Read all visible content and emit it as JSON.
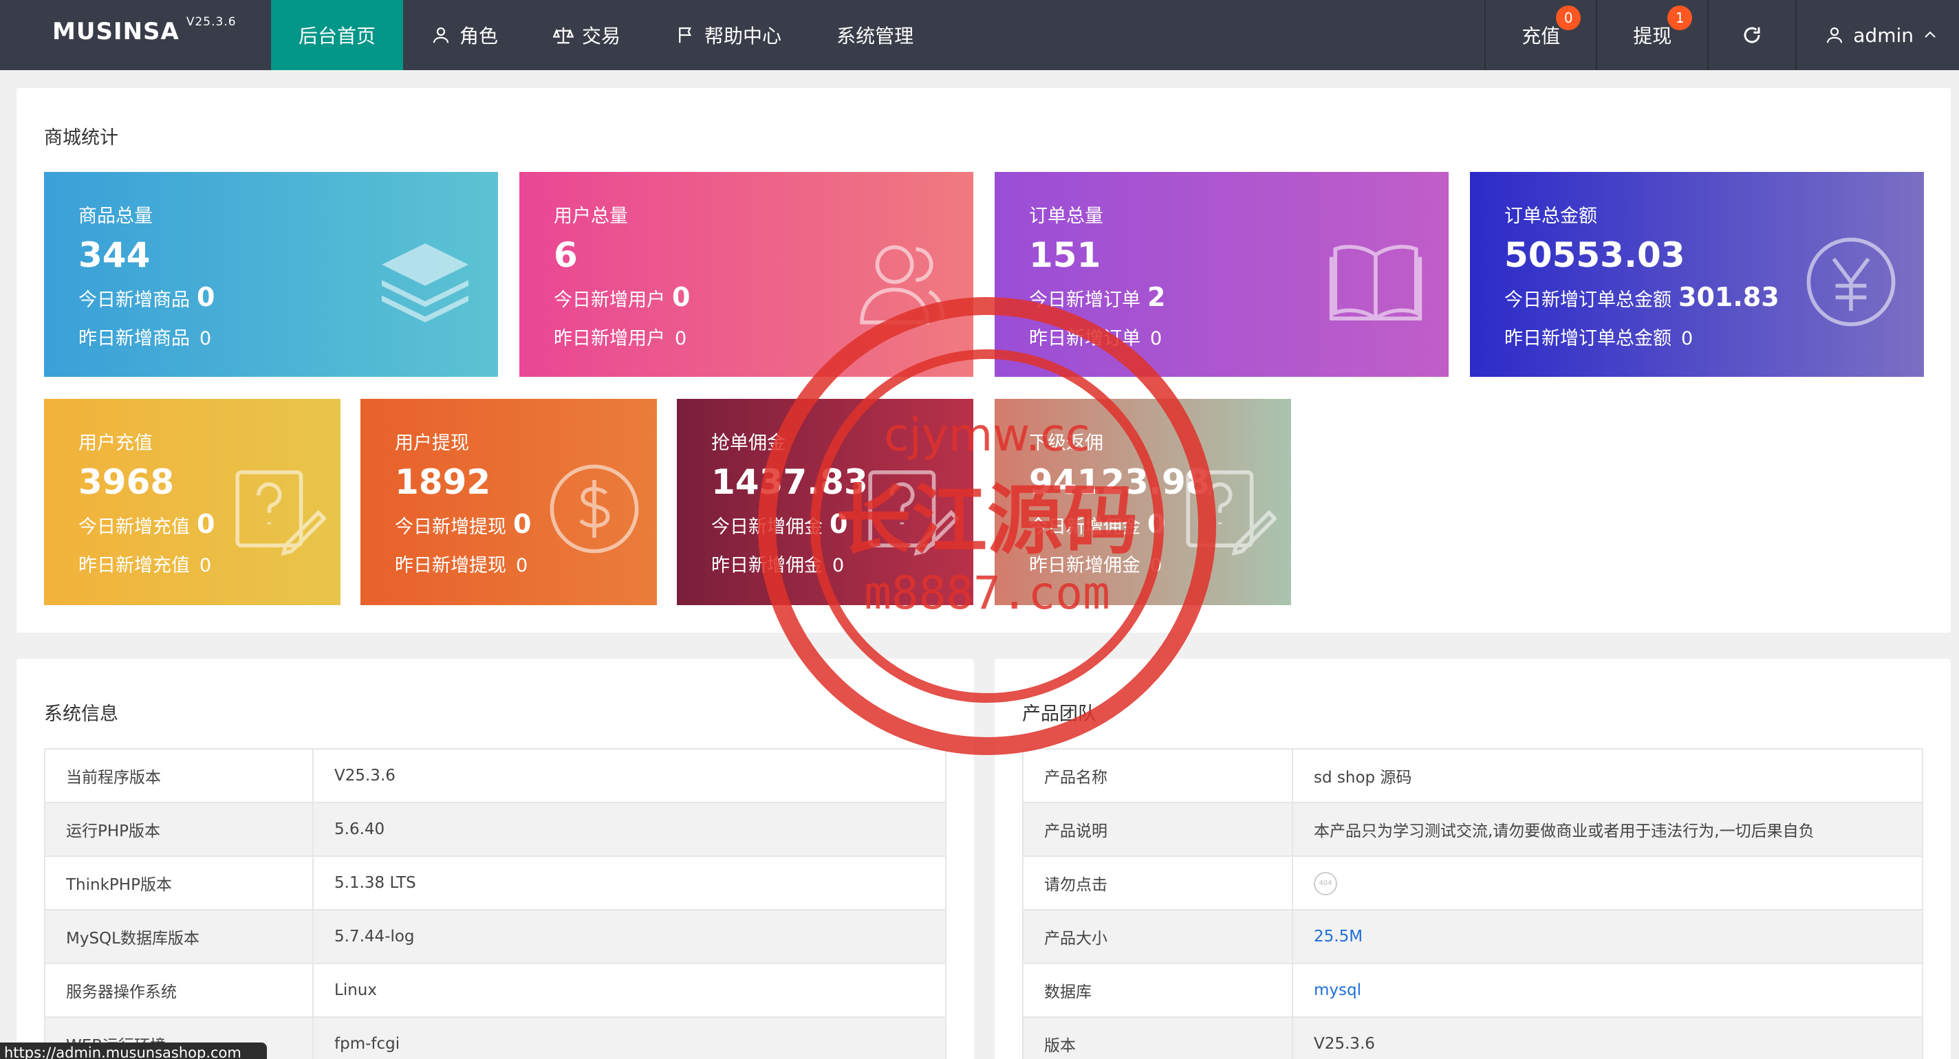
{
  "header": {
    "brand": "MUSINSA",
    "version": "V25.3.6",
    "nav": [
      {
        "label": "后台首页",
        "icon": "",
        "active": true
      },
      {
        "label": "角色",
        "icon": "user-icon"
      },
      {
        "label": "交易",
        "icon": "scale-icon"
      },
      {
        "label": "帮助中心",
        "icon": "flag-icon"
      },
      {
        "label": "系统管理",
        "icon": ""
      }
    ],
    "recharge": {
      "label": "充值",
      "badge": "0"
    },
    "withdraw": {
      "label": "提现",
      "badge": "1"
    },
    "refresh_icon": "refresh-icon",
    "user": {
      "label": "admin",
      "icon": "user-icon"
    }
  },
  "stats": {
    "title": "商城统计",
    "cards": [
      {
        "label": "商品总量",
        "value": "344",
        "today_label": "今日新增商品",
        "today": "0",
        "yesterday_label": "昨日新增商品",
        "yesterday": "0",
        "icon": "layers-icon"
      },
      {
        "label": "用户总量",
        "value": "6",
        "today_label": "今日新增用户",
        "today": "0",
        "yesterday_label": "昨日新增用户",
        "yesterday": "0",
        "icon": "users-icon"
      },
      {
        "label": "订单总量",
        "value": "151",
        "today_label": "今日新增订单",
        "today": "2",
        "yesterday_label": "昨日新增订单",
        "yesterday": "0",
        "icon": "book-icon"
      },
      {
        "label": "订单总金额",
        "value": "50553.03",
        "today_label": "今日新增订单总金额",
        "today": "301.83",
        "yesterday_label": "昨日新增订单总金额",
        "yesterday": "0",
        "icon": "yen-icon"
      },
      {
        "label": "用户充值",
        "value": "3968",
        "today_label": "今日新增充值",
        "today": "0",
        "yesterday_label": "昨日新增充值",
        "yesterday": "0",
        "icon": "question-edit-icon"
      },
      {
        "label": "用户提现",
        "value": "1892",
        "today_label": "今日新增提现",
        "today": "0",
        "yesterday_label": "昨日新增提现",
        "yesterday": "0",
        "icon": "dollar-icon"
      },
      {
        "label": "抢单佣金",
        "value": "1437.83",
        "today_label": "今日新增佣金",
        "today": "0",
        "yesterday_label": "昨日新增佣金",
        "yesterday": "0",
        "icon": "question-edit-icon"
      },
      {
        "label": "下级返佣",
        "value": "94123.98",
        "today_label": "今日新增佣金",
        "today": "0",
        "yesterday_label": "昨日新增佣金",
        "yesterday": "0",
        "icon": "question-edit-icon"
      }
    ]
  },
  "sysinfo": {
    "title": "系统信息",
    "rows": [
      {
        "k": "当前程序版本",
        "v": "V25.3.6"
      },
      {
        "k": "运行PHP版本",
        "v": "5.6.40"
      },
      {
        "k": "ThinkPHP版本",
        "v": "5.1.38 LTS"
      },
      {
        "k": "MySQL数据库版本",
        "v": "5.7.44-log"
      },
      {
        "k": "服务器操作系统",
        "v": "Linux"
      },
      {
        "k": "WEB运行环境",
        "v": "fpm-fcgi"
      }
    ]
  },
  "team": {
    "title": "产品团队",
    "rows": [
      {
        "k": "产品名称",
        "v": "sd shop 源码"
      },
      {
        "k": "产品说明",
        "v": "本产品只为学习测试交流,请勿要做商业或者用于违法行为,一切后果自负"
      },
      {
        "k": "请勿点击",
        "v": "404"
      },
      {
        "k": "产品大小",
        "v": "25.5M"
      },
      {
        "k": "数据库",
        "v": "mysql"
      },
      {
        "k": "版本",
        "v": "V25.3.6"
      }
    ]
  },
  "statusbar": "https://admin.musunsashop.com",
  "watermark": {
    "line1": "cjymw.cc",
    "line2": "长江源码",
    "line3": "m8887.com"
  }
}
